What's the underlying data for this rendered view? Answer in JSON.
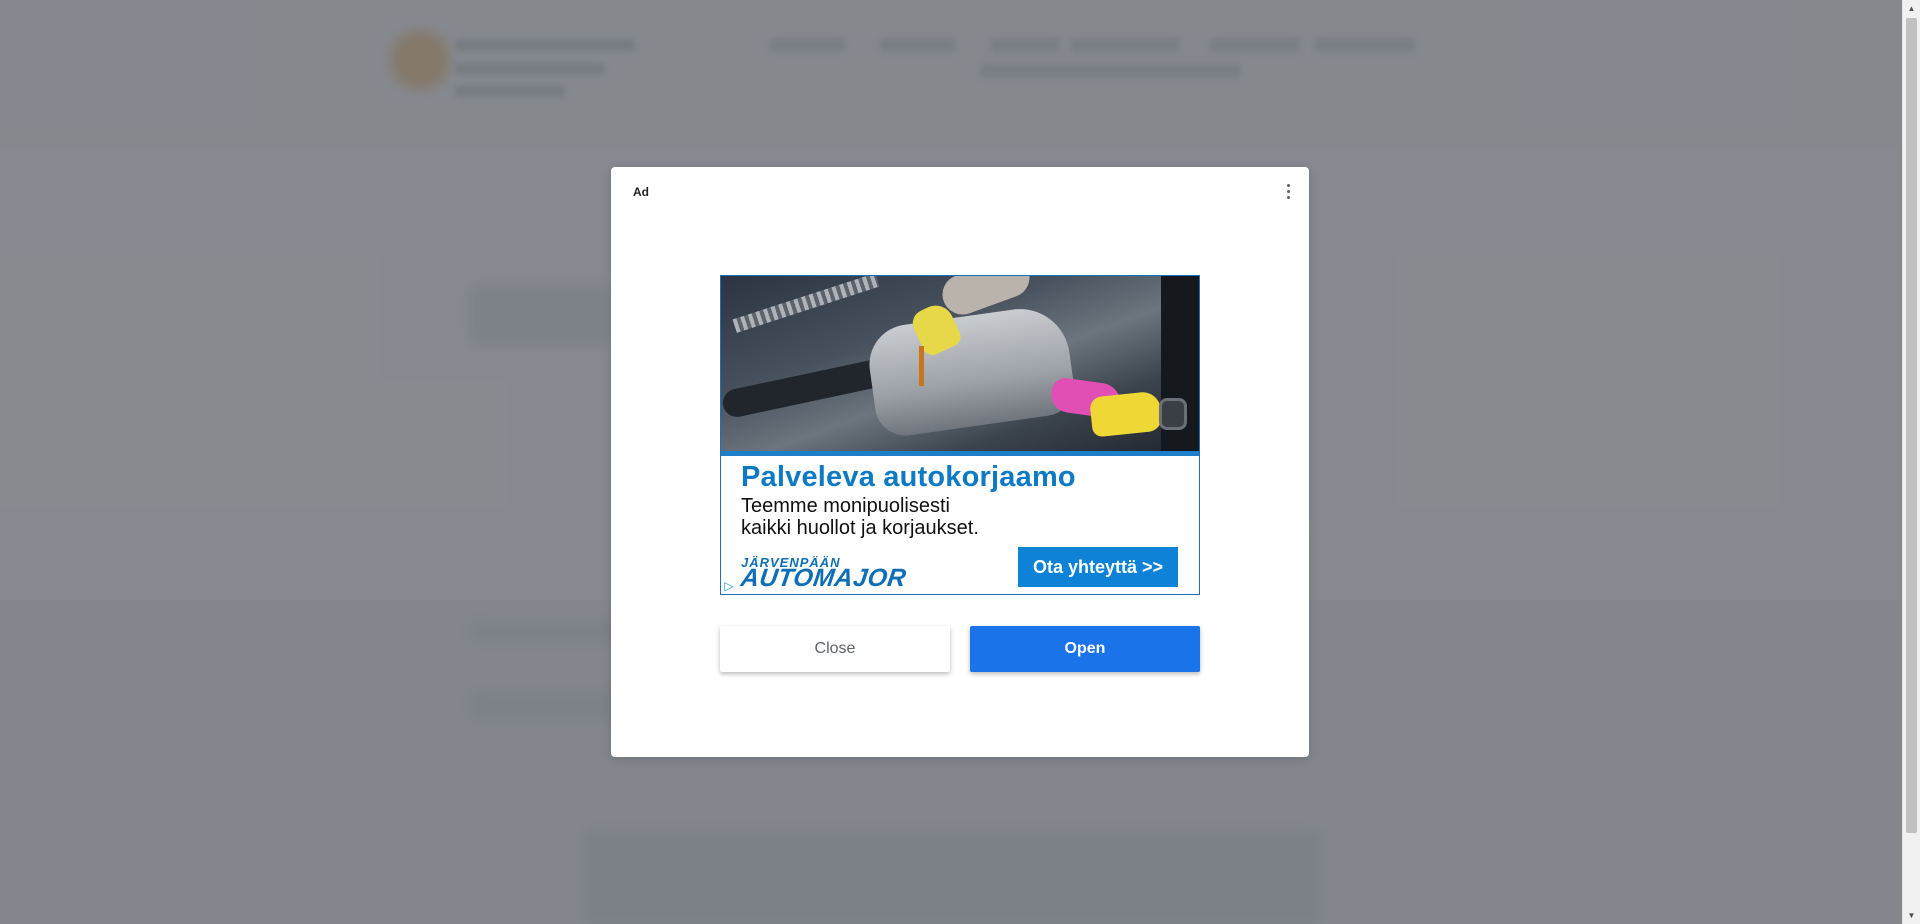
{
  "modal": {
    "ad_label": "Ad",
    "menu_icon": "more-vert-icon",
    "close_label": "Close",
    "open_label": "Open",
    "open_color": "#1a73e8"
  },
  "creative": {
    "headline": "Palveleva autokorjaamo",
    "body_line1": "Teemme monipuolisesti",
    "body_line2": "kaikki huollot ja korjaukset.",
    "brand_top": "JÄRVENPÄÄN",
    "brand_name": "AUTOMAJOR",
    "cta": "Ota yhteyttä >>",
    "accent_color": "#0f7ac4",
    "adchoices_icon": "adchoices-icon"
  }
}
